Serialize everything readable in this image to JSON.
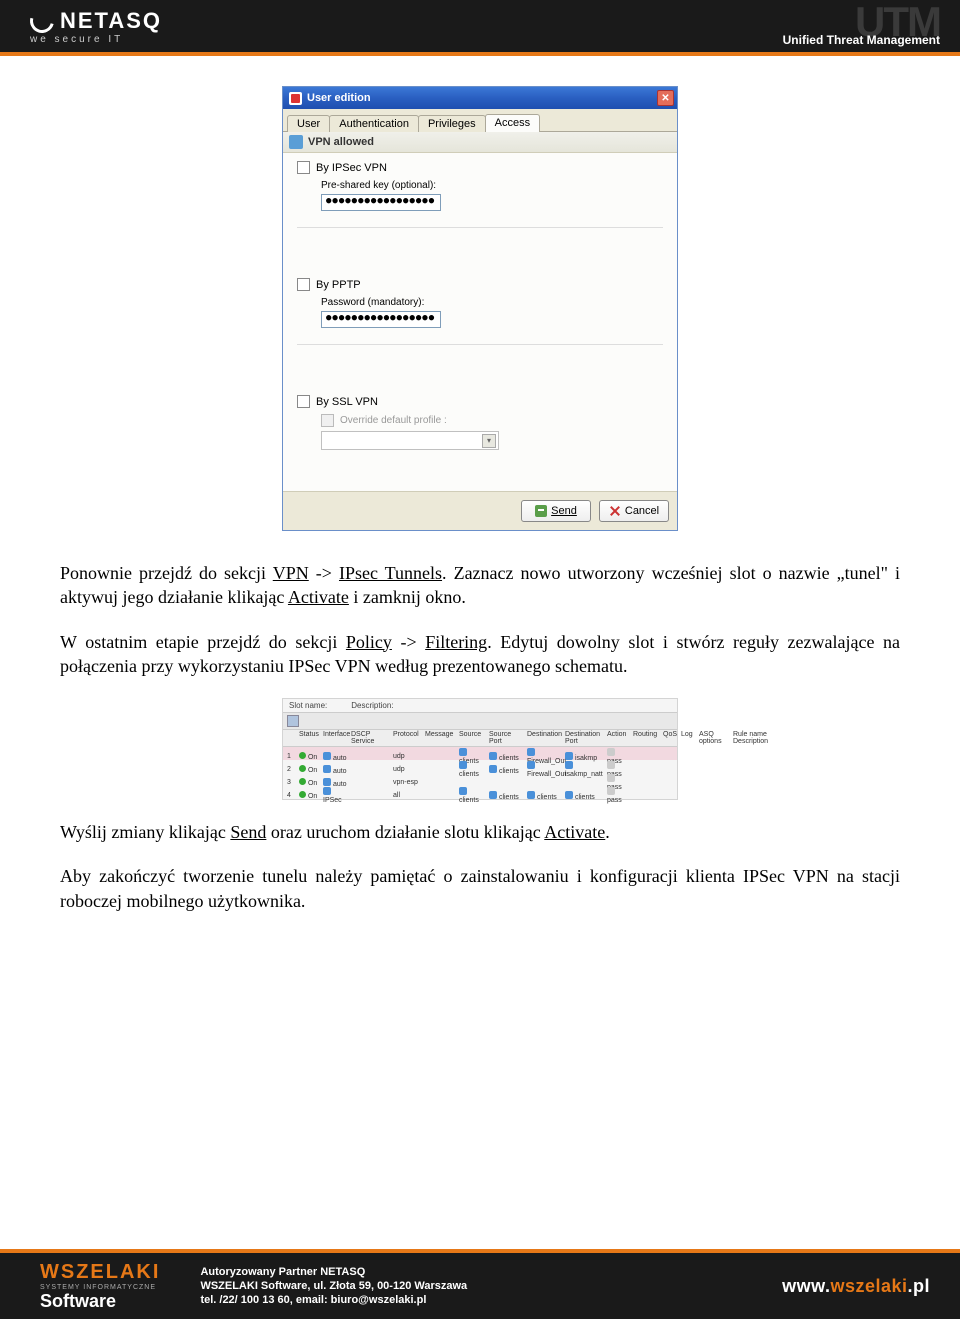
{
  "header": {
    "brand": "NETASQ",
    "tagline": "we secure IT",
    "utm_big": "UTM",
    "utm_sub": "Unified Threat Management"
  },
  "dialog": {
    "title": "User edition",
    "tabs": {
      "user": "User",
      "auth": "Authentication",
      "priv": "Privileges",
      "access": "Access"
    },
    "section_title": "VPN allowed",
    "ipsec": {
      "label": "By IPSec VPN",
      "psk_label": "Pre-shared key (optional):",
      "psk_value": "●●●●●●●●●●●●●●●●●"
    },
    "pptp": {
      "label": "By PPTP",
      "pass_label": "Password (mandatory):",
      "pass_value": "●●●●●●●●●●●●●●●●●"
    },
    "ssl": {
      "label": "By SSL VPN",
      "override_label": "Override default profile :"
    },
    "buttons": {
      "send": "Send",
      "cancel": "Cancel"
    }
  },
  "paragraphs": {
    "p1a": "Ponownie przejdź do sekcji ",
    "p1_vpn": "VPN",
    "p1_arrow": " -> ",
    "p1_ipsec": "IPsec Tunnels",
    "p1b": ". Zaznacz nowo utworzony wcześniej slot o nazwie „tunel\" i aktywuj jego działanie klikając ",
    "p1_activate": "Activate",
    "p1c": " i zamknij okno.",
    "p2a": "W ostatnim etapie przejdź do sekcji ",
    "p2_policy": "Policy",
    "p2_arrow": " -> ",
    "p2_filtering": "Filtering",
    "p2b": ". Edytuj dowolny slot i stwórz reguły zezwalające na połączenia przy wykorzystaniu IPSec VPN według prezentowanego schematu.",
    "p3a": "Wyślij zmiany klikając ",
    "p3_send": "Send",
    "p3b": " oraz uruchom działanie slotu klikając ",
    "p3_activate": "Activate",
    "p3c": ".",
    "p4": "Aby zakończyć tworzenie tunelu należy pamiętać o zainstalowaniu i konfiguracji klienta IPSec VPN na stacji roboczej mobilnego użytkownika."
  },
  "filter_table": {
    "slot_name_label": "Slot name:",
    "desc_label": "Description:",
    "cols": [
      "",
      "Status",
      "Interface",
      "DSCP Service",
      "Protocol",
      "Message",
      "Source",
      "Source Port",
      "Destination",
      "Destination Port",
      "Action",
      "Routing",
      "QoS",
      "Log",
      "ASQ options",
      "Rule name  Description"
    ],
    "rows": [
      {
        "n": "1",
        "status": "On",
        "iface": "auto",
        "dscp": "",
        "proto": "udp",
        "msg": "",
        "src": "clients",
        "sp": "clients",
        "dst": "Firewall_Out",
        "dp": "isakmp",
        "act": "pass"
      },
      {
        "n": "2",
        "status": "On",
        "iface": "auto",
        "dscp": "",
        "proto": "udp",
        "msg": "",
        "src": "clients",
        "sp": "clients",
        "dst": "Firewall_Out",
        "dp": "isakmp_natt",
        "act": "pass"
      },
      {
        "n": "3",
        "status": "On",
        "iface": "auto",
        "dscp": "",
        "proto": "vpn-esp",
        "msg": "",
        "src": "",
        "sp": "",
        "dst": "",
        "dp": "",
        "act": "pass"
      },
      {
        "n": "4",
        "status": "On",
        "iface": "IPSec",
        "dscp": "",
        "proto": "all",
        "msg": "",
        "src": "clients",
        "sp": "clients",
        "dst": "clients",
        "dp": "clients",
        "act": "pass"
      }
    ]
  },
  "footer": {
    "logo_top": "WSZELAKI",
    "logo_mid": "SYSTEMY INFORMATYCZNE",
    "logo_bot": "Software",
    "addr1": "Autoryzowany Partner NETASQ",
    "addr2": "WSZELAKI Software, ul. Złota 59, 00-120 Warszawa",
    "addr3": "tel. /22/ 100 13 60, email: biuro@wszelaki.pl",
    "url_pre": "www.",
    "url_main": "wszelaki",
    "url_suf": ".pl"
  }
}
